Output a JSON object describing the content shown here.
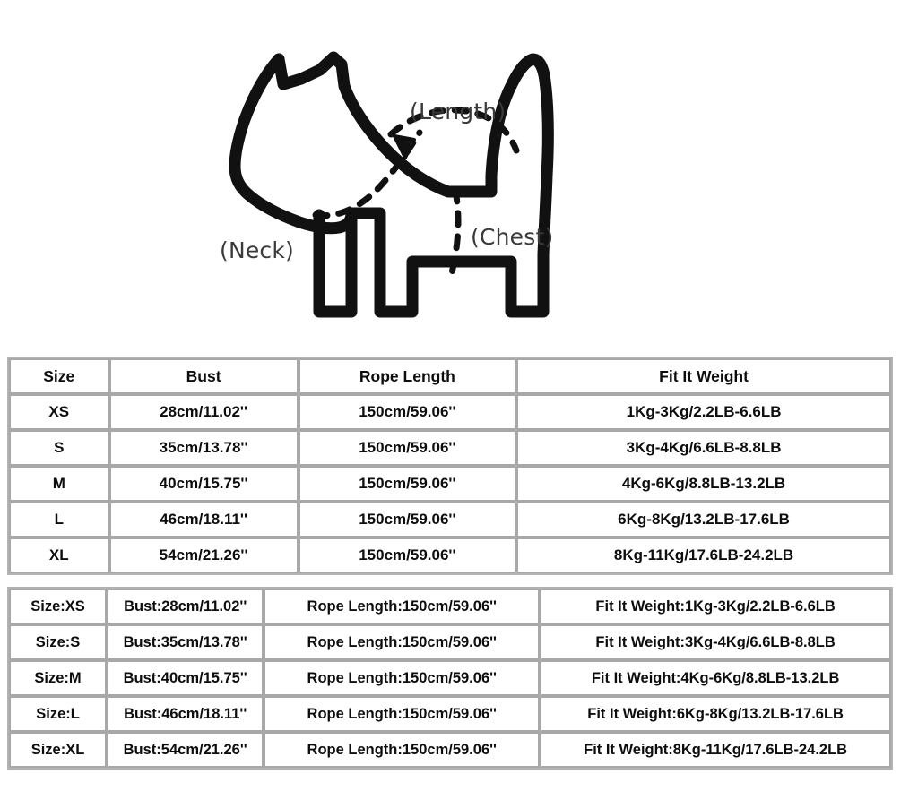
{
  "illustration": {
    "alt": "dog-measurement-diagram",
    "labels": [
      {
        "id": "length",
        "text": "(Length)"
      },
      {
        "id": "neck",
        "text": "(Neck)"
      },
      {
        "id": "chest",
        "text": "(Chest)"
      }
    ],
    "outline_color": "#111111",
    "dash_color": "#111111",
    "label_color": "#3a3a3a"
  },
  "primary_table": {
    "headers": [
      "Size",
      "Bust",
      "Rope Length",
      "Fit It Weight"
    ],
    "rows": [
      {
        "size": "XS",
        "bust": "28cm/11.02''",
        "rope": "150cm/59.06''",
        "weight": "1Kg-3Kg/2.2LB-6.6LB"
      },
      {
        "size": "S",
        "bust": "35cm/13.78''",
        "rope": "150cm/59.06''",
        "weight": "3Kg-4Kg/6.6LB-8.8LB"
      },
      {
        "size": "M",
        "bust": "40cm/15.75''",
        "rope": "150cm/59.06''",
        "weight": "4Kg-6Kg/8.8LB-13.2LB"
      },
      {
        "size": "L",
        "bust": "46cm/18.11''",
        "rope": "150cm/59.06''",
        "weight": "6Kg-8Kg/13.2LB-17.6LB"
      },
      {
        "size": "XL",
        "bust": "54cm/21.26''",
        "rope": "150cm/59.06''",
        "weight": "8Kg-11Kg/17.6LB-24.2LB"
      }
    ]
  },
  "secondary_table": {
    "rows": [
      {
        "size": "Size:XS",
        "bust": "Bust:28cm/11.02''",
        "rope": "Rope Length:150cm/59.06''",
        "weight": "Fit It Weight:1Kg-3Kg/2.2LB-6.6LB"
      },
      {
        "size": "Size:S",
        "bust": "Bust:35cm/13.78''",
        "rope": "Rope Length:150cm/59.06''",
        "weight": "Fit It Weight:3Kg-4Kg/6.6LB-8.8LB"
      },
      {
        "size": "Size:M",
        "bust": "Bust:40cm/15.75''",
        "rope": "Rope Length:150cm/59.06''",
        "weight": "Fit It Weight:4Kg-6Kg/8.8LB-13.2LB"
      },
      {
        "size": "Size:L",
        "bust": "Bust:46cm/18.11''",
        "rope": "Rope Length:150cm/59.06''",
        "weight": "Fit It Weight:6Kg-8Kg/13.2LB-17.6LB"
      },
      {
        "size": "Size:XL",
        "bust": "Bust:54cm/21.26''",
        "rope": "Rope Length:150cm/59.06''",
        "weight": "Fit It Weight:8Kg-11Kg/17.6LB-24.2LB"
      }
    ]
  },
  "colors": {
    "background": "#ffffff",
    "table_border": "#a8a8a8",
    "text": "#0d0d0d"
  }
}
